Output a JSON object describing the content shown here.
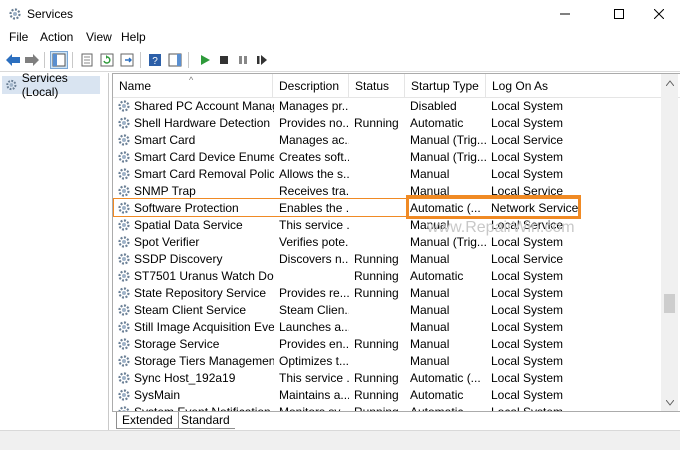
{
  "window": {
    "title": "Services"
  },
  "menu": [
    "File",
    "Action",
    "View",
    "Help"
  ],
  "tree": {
    "root_label": "Services (Local)"
  },
  "columns": {
    "name": "Name",
    "description": "Description",
    "status": "Status",
    "startup": "Startup Type",
    "logon": "Log On As"
  },
  "rows": [
    {
      "name": "Shared PC Account Manager",
      "description": "Manages pr...",
      "status": "",
      "startup": "Disabled",
      "logon": "Local System"
    },
    {
      "name": "Shell Hardware Detection",
      "description": "Provides no...",
      "status": "Running",
      "startup": "Automatic",
      "logon": "Local System"
    },
    {
      "name": "Smart Card",
      "description": "Manages ac...",
      "status": "",
      "startup": "Manual (Trig...",
      "logon": "Local Service"
    },
    {
      "name": "Smart Card Device Enumera...",
      "description": "Creates soft...",
      "status": "",
      "startup": "Manual (Trig...",
      "logon": "Local System"
    },
    {
      "name": "Smart Card Removal Policy",
      "description": "Allows the s...",
      "status": "",
      "startup": "Manual",
      "logon": "Local System"
    },
    {
      "name": "SNMP Trap",
      "description": "Receives tra...",
      "status": "",
      "startup": "Manual",
      "logon": "Local Service"
    },
    {
      "name": "Software Protection",
      "description": "Enables the ...",
      "status": "",
      "startup": "Automatic (...",
      "logon": "Network Service"
    },
    {
      "name": "Spatial Data Service",
      "description": "This service ...",
      "status": "",
      "startup": "Manual",
      "logon": "Local Service"
    },
    {
      "name": "Spot Verifier",
      "description": "Verifies pote...",
      "status": "",
      "startup": "Manual (Trig...",
      "logon": "Local System"
    },
    {
      "name": "SSDP Discovery",
      "description": "Discovers n...",
      "status": "Running",
      "startup": "Manual",
      "logon": "Local Service"
    },
    {
      "name": "ST7501 Uranus Watch Dog",
      "description": "",
      "status": "Running",
      "startup": "Automatic",
      "logon": "Local System"
    },
    {
      "name": "State Repository Service",
      "description": "Provides re...",
      "status": "Running",
      "startup": "Manual",
      "logon": "Local System"
    },
    {
      "name": "Steam Client Service",
      "description": "Steam Clien...",
      "status": "",
      "startup": "Manual",
      "logon": "Local System"
    },
    {
      "name": "Still Image Acquisition Events",
      "description": "Launches a...",
      "status": "",
      "startup": "Manual",
      "logon": "Local System"
    },
    {
      "name": "Storage Service",
      "description": "Provides en...",
      "status": "Running",
      "startup": "Manual",
      "logon": "Local System"
    },
    {
      "name": "Storage Tiers Management",
      "description": "Optimizes t...",
      "status": "",
      "startup": "Manual",
      "logon": "Local System"
    },
    {
      "name": "Sync Host_192a19",
      "description": "This service ...",
      "status": "Running",
      "startup": "Automatic (...",
      "logon": "Local System"
    },
    {
      "name": "SysMain",
      "description": "Maintains a...",
      "status": "Running",
      "startup": "Automatic",
      "logon": "Local System"
    },
    {
      "name": "System Event Notification S...",
      "description": "Monitors sy...",
      "status": "Running",
      "startup": "Automatic",
      "logon": "Local System"
    }
  ],
  "tabs": [
    "Extended",
    "Standard"
  ],
  "watermark": "www.RepairWin.com",
  "colors": {
    "highlight": "#f08a24",
    "selection": "#d9e4f1"
  }
}
